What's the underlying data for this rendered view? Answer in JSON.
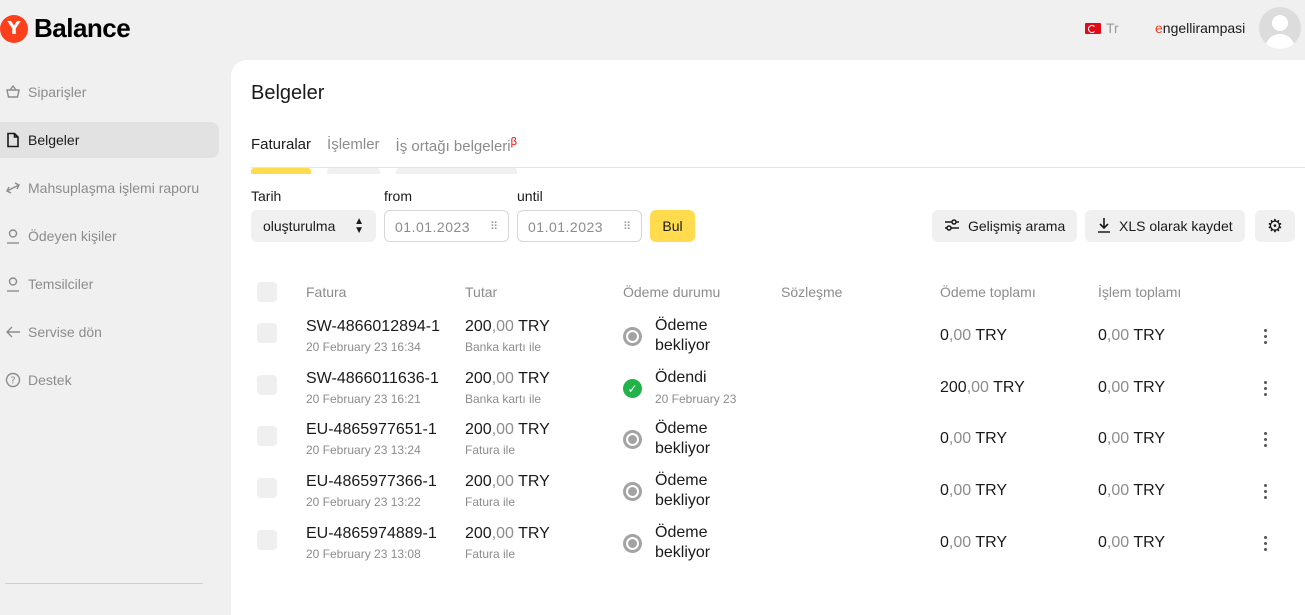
{
  "header": {
    "logo_letter": "Y",
    "app_name": "Balance",
    "language": "Tr",
    "username_first": "e",
    "username_rest": "ngellirampasi"
  },
  "sidebar": {
    "items": [
      {
        "label": "Siparişler",
        "icon": "basket-icon"
      },
      {
        "label": "Belgeler",
        "icon": "document-icon",
        "active": true
      },
      {
        "label": "Mahsuplaşma işlemi raporu",
        "icon": "transfer-arrows-icon"
      },
      {
        "label": "Ödeyen kişiler",
        "icon": "person-icon"
      },
      {
        "label": "Temsilciler",
        "icon": "person-icon"
      },
      {
        "label": "Servise dön",
        "icon": "arrow-left-icon"
      },
      {
        "label": "Destek",
        "icon": "help-icon"
      }
    ]
  },
  "main": {
    "title": "Belgeler",
    "tabs": [
      {
        "label": "Faturalar",
        "active": true
      },
      {
        "label": "İşlemler"
      },
      {
        "label": "İş ortağı belgeleri",
        "badge": "β"
      }
    ],
    "filters": {
      "date_label": "Tarih",
      "date_type": "oluşturulma",
      "from_label": "from",
      "from_value": "01.01.2023",
      "until_label": "until",
      "until_value": "01.01.2023",
      "find_button": "Bul",
      "advanced_search": "Gelişmiş arama",
      "save_xls": "XLS olarak kaydet"
    },
    "table": {
      "headers": [
        "Fatura",
        "Tutar",
        "Ödeme durumu",
        "Sözleşme",
        "Ödeme toplamı",
        "İşlem toplamı"
      ],
      "rows": [
        {
          "invoice": "SW-4866012894-1",
          "date": "20 February 23 16:34",
          "amount_int": "200",
          "amount_dec": ",00",
          "currency": " TRY",
          "method": "Banka kartı ile",
          "status": "Ödeme bekliyor",
          "status_type": "wait",
          "status_date": "",
          "paid_int": "0",
          "paid_dec": ",00",
          "paid_cur": " TRY",
          "txn_int": "0",
          "txn_dec": ",00",
          "txn_cur": " TRY"
        },
        {
          "invoice": "SW-4866011636-1",
          "date": "20 February 23 16:21",
          "amount_int": "200",
          "amount_dec": ",00",
          "currency": " TRY",
          "method": "Banka kartı ile",
          "status": "Ödendi",
          "status_type": "paid",
          "status_date": "20 February 23",
          "paid_int": "200",
          "paid_dec": ",00",
          "paid_cur": " TRY",
          "txn_int": "0",
          "txn_dec": ",00",
          "txn_cur": " TRY"
        },
        {
          "invoice": "EU-4865977651-1",
          "date": "20 February 23 13:24",
          "amount_int": "200",
          "amount_dec": ",00",
          "currency": " TRY",
          "method": "Fatura ile",
          "status": "Ödeme bekliyor",
          "status_type": "wait",
          "status_date": "",
          "paid_int": "0",
          "paid_dec": ",00",
          "paid_cur": " TRY",
          "txn_int": "0",
          "txn_dec": ",00",
          "txn_cur": " TRY"
        },
        {
          "invoice": "EU-4865977366-1",
          "date": "20 February 23 13:22",
          "amount_int": "200",
          "amount_dec": ",00",
          "currency": " TRY",
          "method": "Fatura ile",
          "status": "Ödeme bekliyor",
          "status_type": "wait",
          "status_date": "",
          "paid_int": "0",
          "paid_dec": ",00",
          "paid_cur": " TRY",
          "txn_int": "0",
          "txn_dec": ",00",
          "txn_cur": " TRY"
        },
        {
          "invoice": "EU-4865974889-1",
          "date": "20 February 23 13:08",
          "amount_int": "200",
          "amount_dec": ",00",
          "currency": " TRY",
          "method": "Fatura ile",
          "status": "Ödeme bekliyor",
          "status_type": "wait",
          "status_date": "",
          "paid_int": "0",
          "paid_dec": ",00",
          "paid_cur": " TRY",
          "txn_int": "0",
          "txn_dec": ",00",
          "txn_cur": " TRY"
        }
      ]
    }
  }
}
